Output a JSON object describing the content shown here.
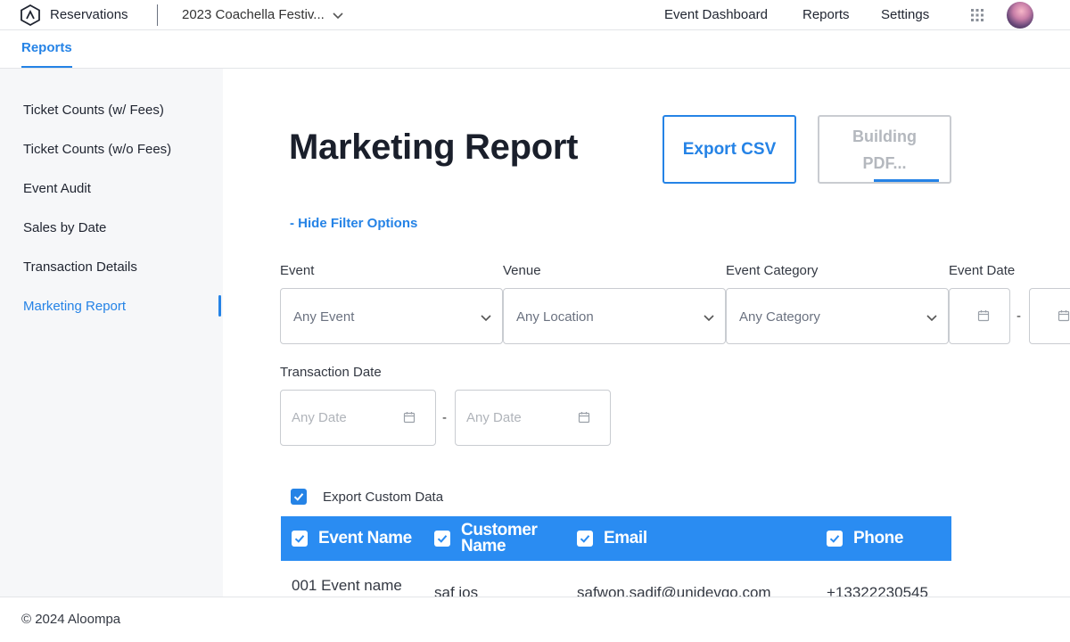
{
  "header": {
    "app_name": "Reservations",
    "event_selector": "2023 Coachella Festiv...",
    "nav": [
      "Event Dashboard",
      "Reports",
      "Settings"
    ],
    "icons": [
      "logo-icon",
      "chevron-down-icon",
      "apps-grid-icon",
      "avatar"
    ]
  },
  "subnav": {
    "active_tab": "Reports"
  },
  "sidebar": {
    "items": [
      {
        "label": "Ticket Counts (w/ Fees)"
      },
      {
        "label": "Ticket Counts (w/o Fees)"
      },
      {
        "label": "Event Audit"
      },
      {
        "label": "Sales by Date"
      },
      {
        "label": "Transaction Details"
      },
      {
        "label": "Marketing Report"
      }
    ],
    "active_item": "Marketing Report"
  },
  "main": {
    "title": "Marketing Report",
    "export_csv": "Export CSV",
    "build_pdf": "Building PDF...",
    "pdf_progress_fraction": 0.5,
    "filter_toggle": "- Hide Filter Options",
    "filters": {
      "event": {
        "label": "Event",
        "value": "Any Event"
      },
      "venue": {
        "label": "Venue",
        "value": "Any Location"
      },
      "category": {
        "label": "Event Category",
        "value": "Any Category"
      },
      "event_date": {
        "label": "Event Date",
        "separator": "-"
      },
      "transaction_date": {
        "label": "Transaction Date",
        "start_placeholder": "Any Date",
        "end_placeholder": "Any Date",
        "separator": "-"
      }
    },
    "export_custom": {
      "label": "Export Custom Data",
      "checked": true
    },
    "table": {
      "columns": [
        "Event Name",
        "Customer\nName",
        "Email",
        "Phone"
      ],
      "columns_checked": [
        true,
        true,
        true,
        true
      ],
      "rows": [
        [
          "001 Event name",
          "saf ios",
          "safwon.sadif@unidevgo.com",
          "+13322230545"
        ]
      ]
    }
  },
  "footer": {
    "copyright": "© 2024 Aloompa"
  },
  "colors": {
    "accent": "#2583e6",
    "table_header": "#2a8cf2",
    "sidebar_bg": "#f6f7f9"
  }
}
